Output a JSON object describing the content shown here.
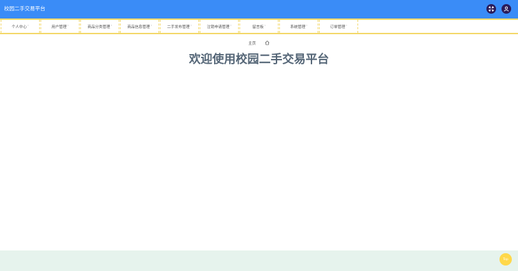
{
  "app": {
    "title": "校园二手交易平台"
  },
  "header": {
    "fullscreen_icon": "expand-icon",
    "user_icon": "user-icon"
  },
  "nav": {
    "items": [
      {
        "label": "个人中心"
      },
      {
        "label": "用户管理"
      },
      {
        "label": "商品分类管理"
      },
      {
        "label": "商品信息管理"
      },
      {
        "label": "二手发布管理"
      },
      {
        "label": "注销申请管理"
      },
      {
        "label": "留言板"
      },
      {
        "label": "系统管理"
      },
      {
        "label": "订单管理"
      }
    ],
    "caret": "˅"
  },
  "breadcrumb": {
    "home": "主页",
    "icon": "home-icon"
  },
  "main": {
    "welcome": "欢迎使用校园二手交易平台"
  },
  "top_button": {
    "label": "Top"
  },
  "colors": {
    "header_bg": "#3a8cf7",
    "nav_border": "#f3d869",
    "footer_bg": "#e6f3ed",
    "top_button": "#ffd84a"
  }
}
